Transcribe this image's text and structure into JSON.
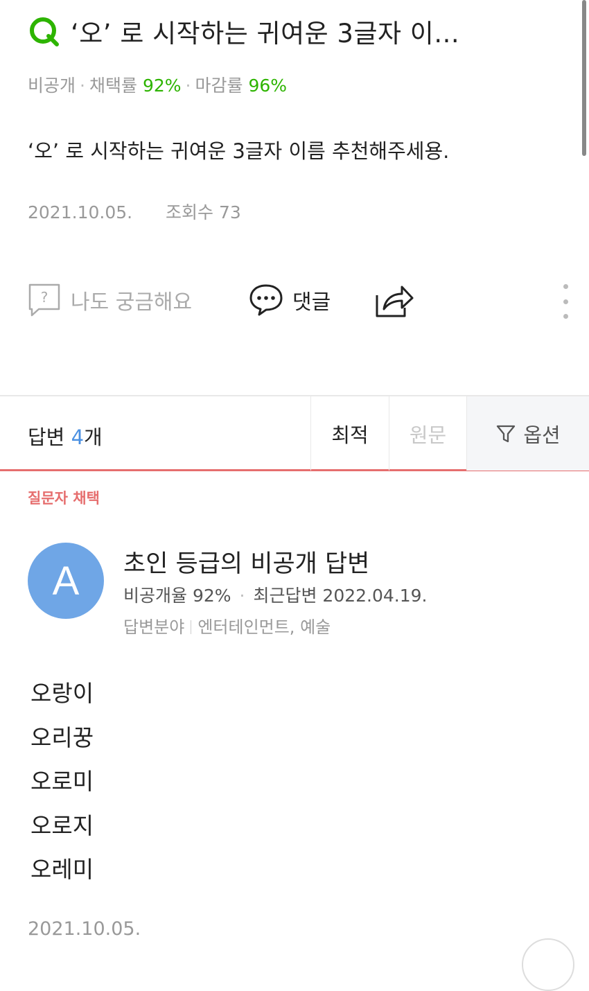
{
  "question": {
    "badge_letter": "Q",
    "title": "‘오’ 로 시작하는 귀여운 3글자 이...",
    "meta": {
      "visibility": "비공개",
      "adoption_label": "채택률",
      "adoption_value": "92%",
      "close_label": "마감률",
      "close_value": "96%"
    },
    "body": "‘오’ 로 시작하는 귀여운 3글자 이름 추천해주세용.",
    "date": "2021.10.05.",
    "views": "조회수 73"
  },
  "actions": {
    "curious_label": "나도 궁금해요",
    "comment_label": "댓글",
    "share_icon": "share-icon",
    "more_icon": "more-vertical-icon"
  },
  "answers_bar": {
    "label": "답변",
    "count": "4",
    "unit": "개",
    "tabs": {
      "best": "최적",
      "origin": "원문",
      "option": "옵션"
    }
  },
  "accepted_label": "질문자 채택",
  "answer": {
    "avatar_letter": "A",
    "name": "초인 등급의 비공개 답변",
    "private_rate": "비공개율 92%",
    "recent": "최근답변 2022.04.19.",
    "field_label": "답변분야",
    "field_value": "엔터테인먼트, 예술",
    "lines": [
      "오랑이",
      "오리꿍",
      "오로미",
      "오로지",
      "오레미"
    ],
    "date": "2021.10.05."
  },
  "colors": {
    "brand_green": "#2db400",
    "accent_blue": "#4a90e2",
    "accepted_red": "#e66e6e",
    "avatar_blue": "#6fa6e6"
  }
}
